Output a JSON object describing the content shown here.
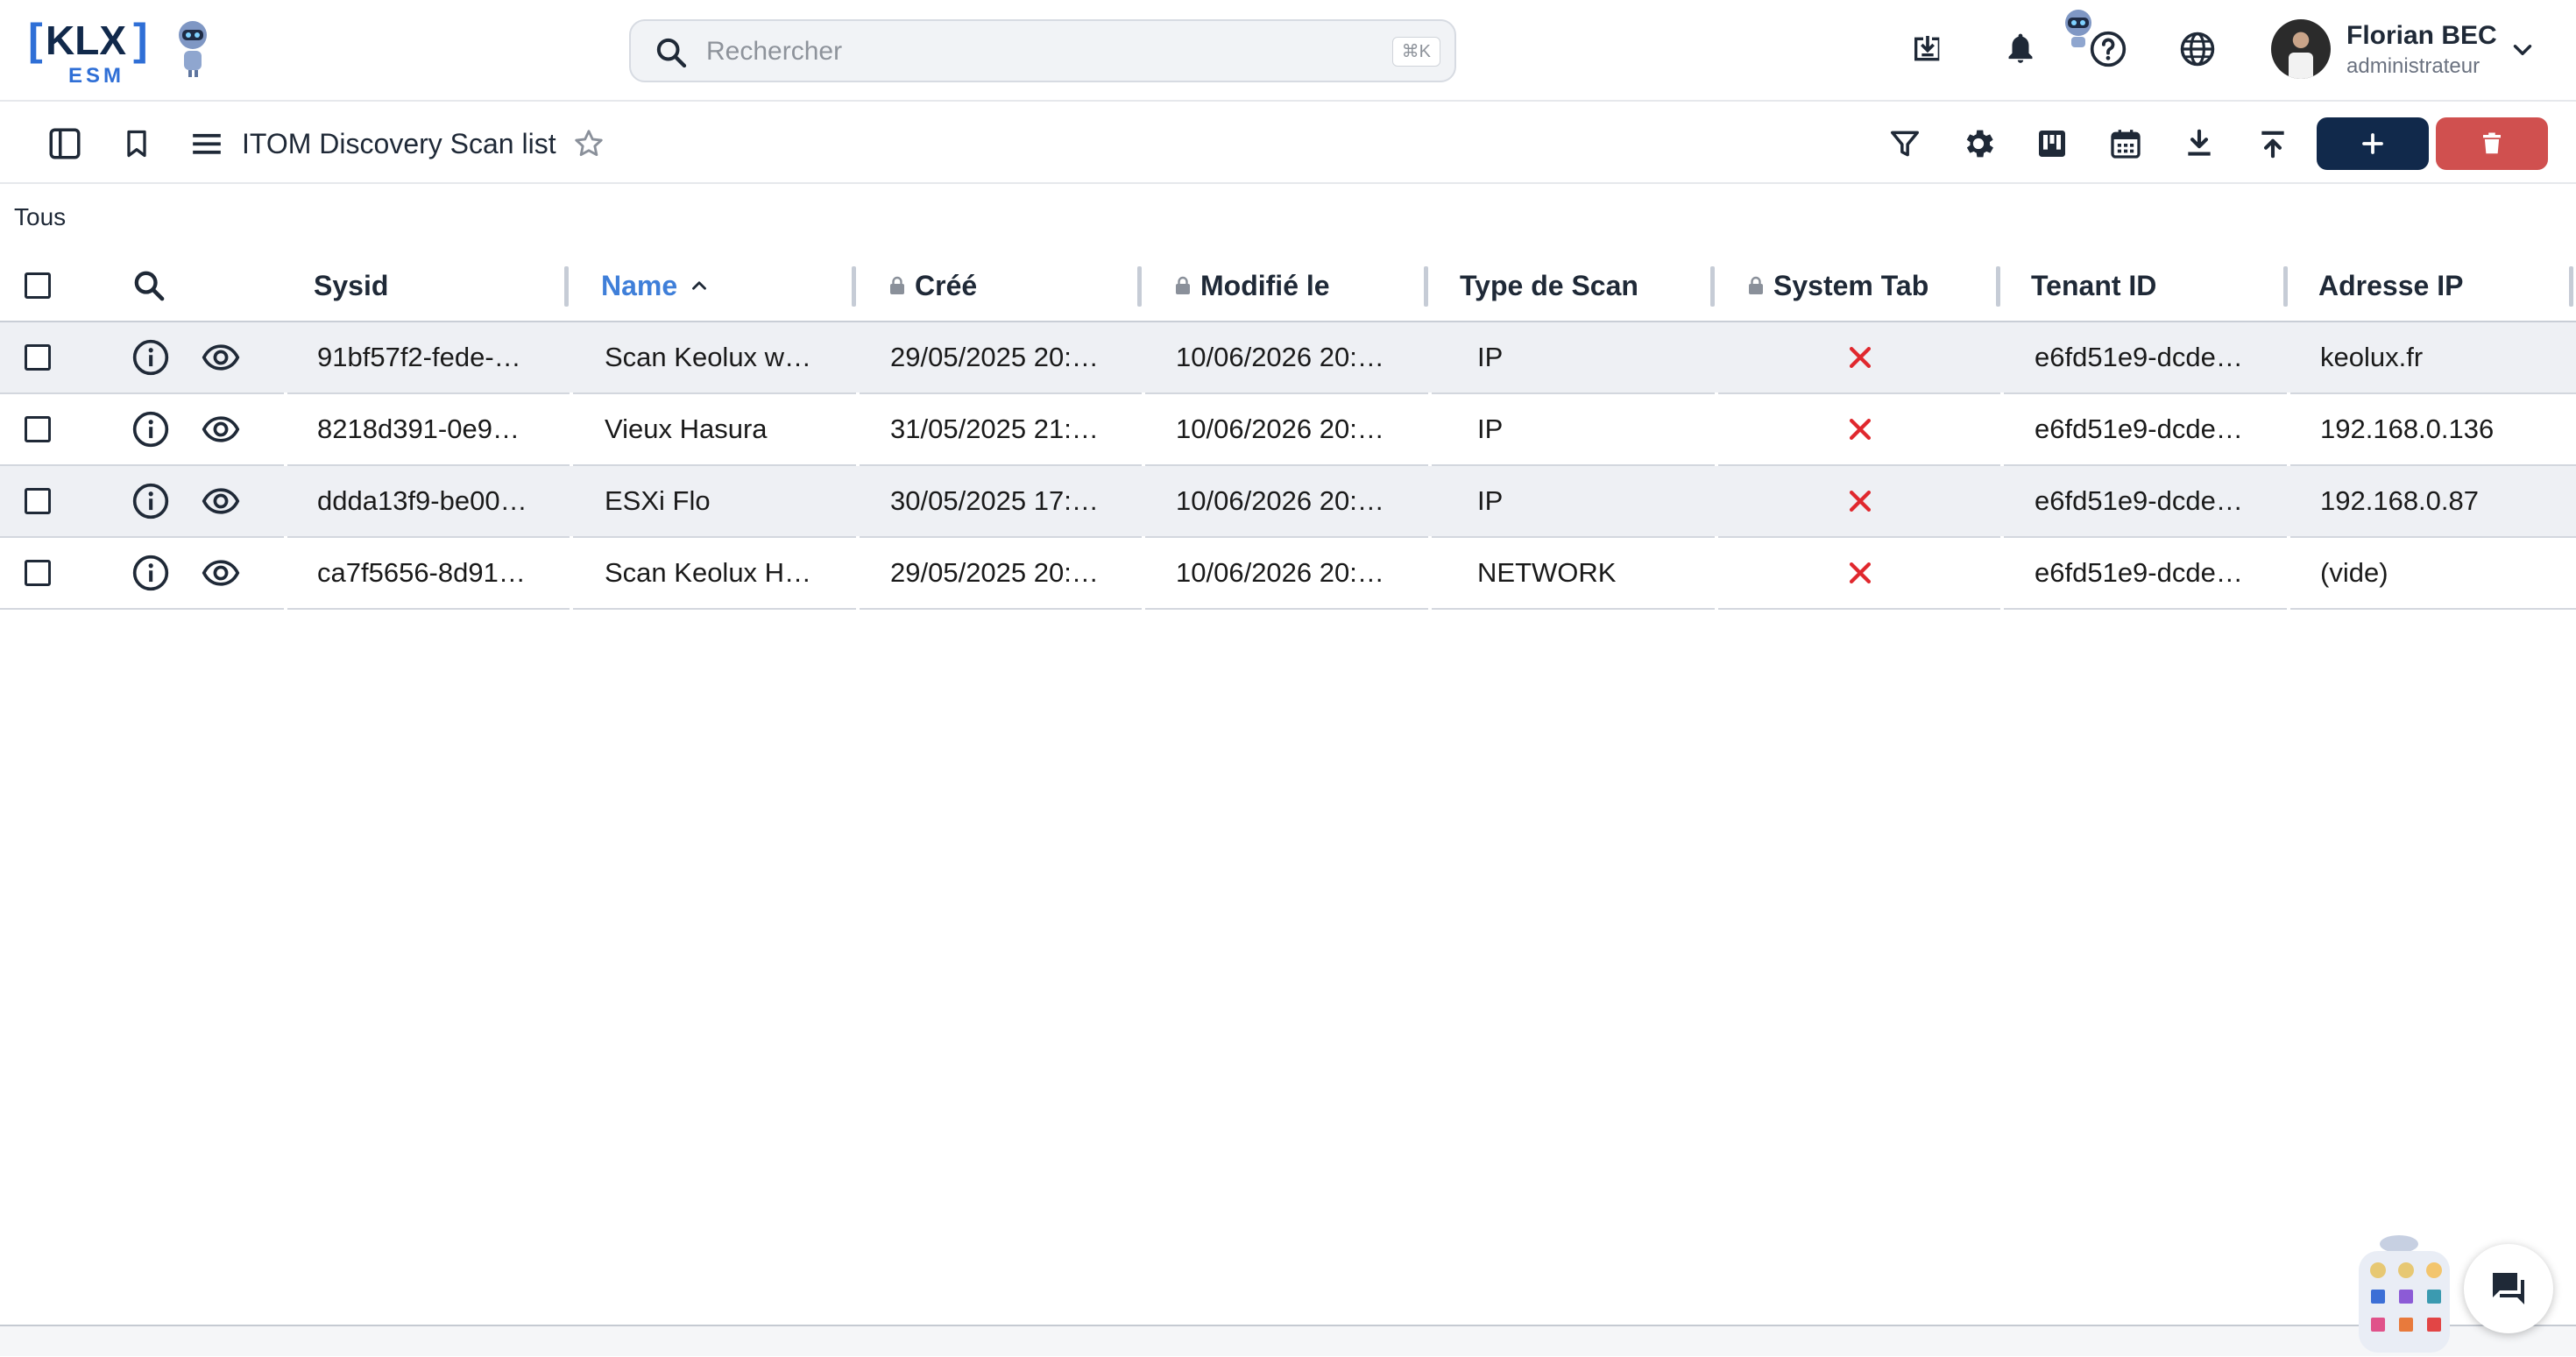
{
  "app": {
    "logo_text": "KLX",
    "logo_sub": "ESM"
  },
  "search": {
    "placeholder": "Rechercher",
    "shortcut": "⌘K"
  },
  "user": {
    "name": "Florian BEC",
    "role": "administrateur"
  },
  "toolbar": {
    "page_title": "ITOM Discovery Scan list"
  },
  "filter": {
    "label": "Tous"
  },
  "table": {
    "columns": [
      {
        "label": "Sysid",
        "locked": false,
        "sorted": ""
      },
      {
        "label": "Name",
        "locked": false,
        "sorted": "asc"
      },
      {
        "label": "Créé",
        "locked": true,
        "sorted": ""
      },
      {
        "label": "Modifié le",
        "locked": true,
        "sorted": ""
      },
      {
        "label": "Type de Scan",
        "locked": false,
        "sorted": ""
      },
      {
        "label": "System Tab",
        "locked": true,
        "sorted": ""
      },
      {
        "label": "Tenant ID",
        "locked": false,
        "sorted": ""
      },
      {
        "label": "Adresse IP",
        "locked": false,
        "sorted": ""
      }
    ],
    "rows": [
      {
        "sysid": "91bf57f2-fede-…",
        "name": "Scan Keolux w…",
        "created": "29/05/2025 20:…",
        "modified": "10/06/2026 20:…",
        "type": "IP",
        "system_tab": "false",
        "tenant": "e6fd51e9-dcde…",
        "ip": "keolux.fr"
      },
      {
        "sysid": "8218d391-0e9…",
        "name": "Vieux Hasura",
        "created": "31/05/2025 21:…",
        "modified": "10/06/2026 20:…",
        "type": "IP",
        "system_tab": "false",
        "tenant": "e6fd51e9-dcde…",
        "ip": "192.168.0.136"
      },
      {
        "sysid": "ddda13f9-be00…",
        "name": "ESXi Flo",
        "created": "30/05/2025 17:…",
        "modified": "10/06/2026 20:…",
        "type": "IP",
        "system_tab": "false",
        "tenant": "e6fd51e9-dcde…",
        "ip": "192.168.0.87"
      },
      {
        "sysid": "ca7f5656-8d91…",
        "name": "Scan Keolux H…",
        "created": "29/05/2025 20:…",
        "modified": "10/06/2026 20:…",
        "type": "NETWORK",
        "system_tab": "false",
        "tenant": "e6fd51e9-dcde…",
        "ip": "(vide)"
      }
    ]
  },
  "colors": {
    "primary": "#11294b",
    "danger": "#d0504f",
    "sort_active": "#3f7fd9",
    "false_mark": "#e0282e",
    "logo_blue": "#2f6fd6"
  },
  "icons": [
    "search-icon",
    "download-box-icon",
    "bell-icon",
    "help-icon",
    "globe-icon",
    "chevron-down-icon",
    "sidebar-toggle-icon",
    "bookmark-icon",
    "menu-icon",
    "star-icon",
    "filter-icon",
    "gear-icon",
    "kanban-icon",
    "calendar-icon",
    "download-icon",
    "upload-icon",
    "plus-icon",
    "trash-icon",
    "info-icon",
    "eye-icon",
    "cross-icon",
    "chat-icon"
  ]
}
